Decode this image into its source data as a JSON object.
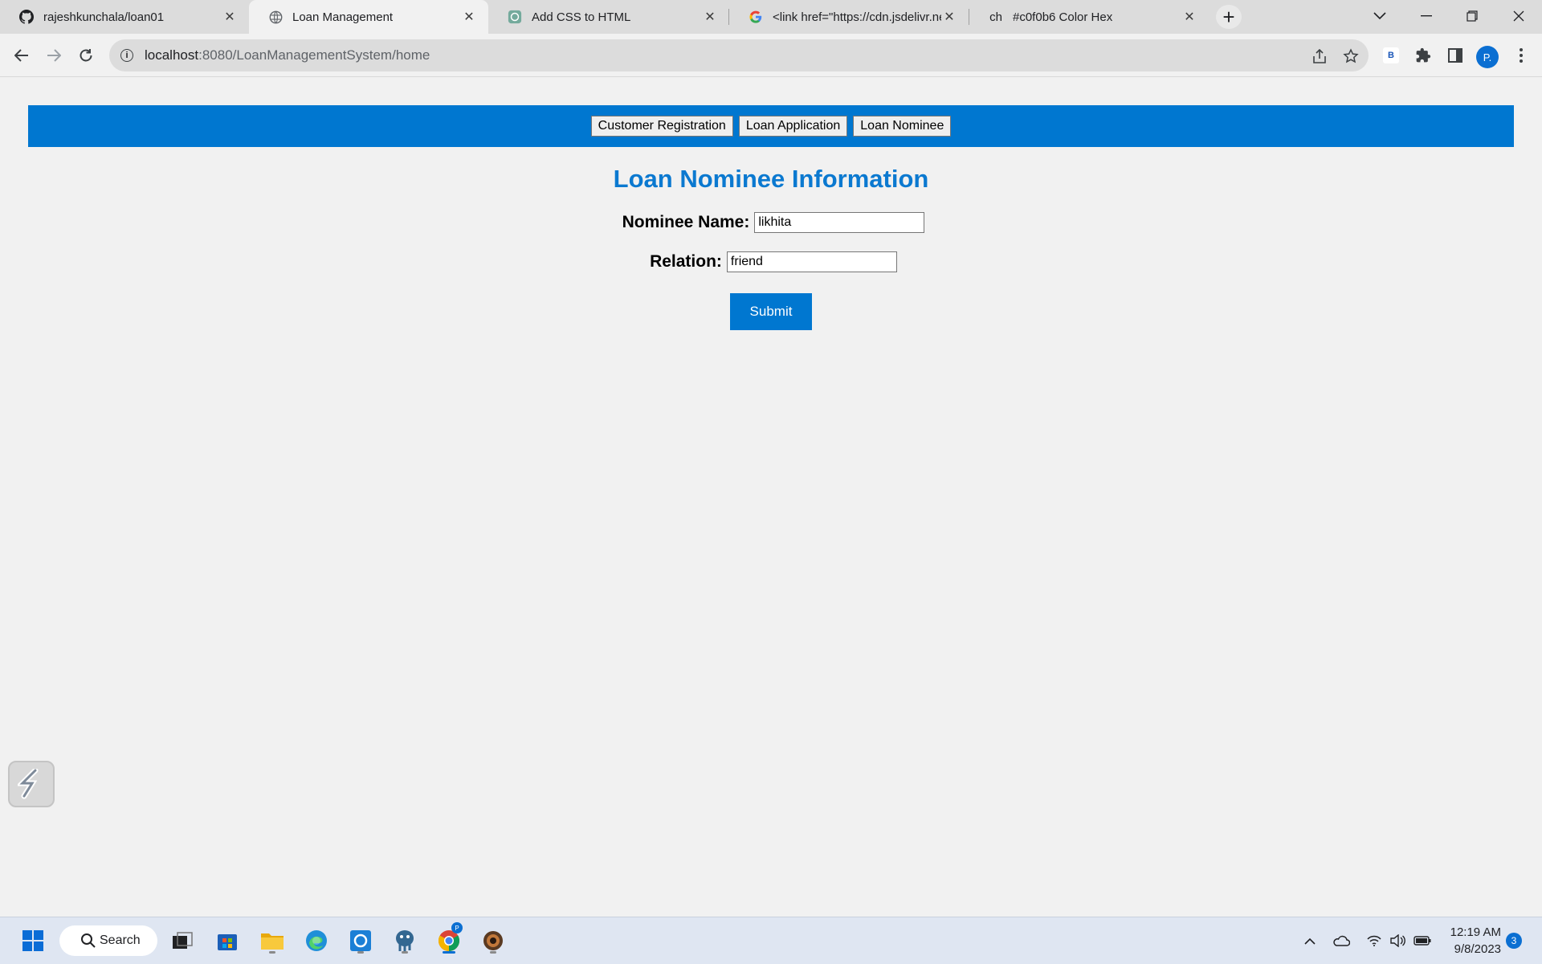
{
  "browser": {
    "tabs": [
      {
        "title": "rajeshkunchala/loan01",
        "favicon": "github-icon",
        "active": false
      },
      {
        "title": "Loan Management",
        "favicon": "globe-icon",
        "active": true
      },
      {
        "title": "Add CSS to HTML",
        "favicon": "chatgpt-icon",
        "active": false
      },
      {
        "title": "<link href=\"https://cdn.jsdelivr.ne",
        "favicon": "google-icon",
        "active": false
      },
      {
        "title": "#c0f0b6 Color Hex",
        "favicon_text": "ch",
        "active": false
      }
    ],
    "address": {
      "host": "localhost",
      "path": ":8080/LoanManagementSystem/home"
    },
    "profile_initial": "P.",
    "extension_badge": "B"
  },
  "page": {
    "nav": {
      "customer_registration": "Customer Registration",
      "loan_application": "Loan Application",
      "loan_nominee": "Loan Nominee"
    },
    "title": "Loan Nominee Information",
    "form": {
      "nominee_name_label": "Nominee Name:",
      "nominee_name_value": "likhita",
      "relation_label": "Relation:",
      "relation_value": "friend",
      "submit_label": "Submit"
    }
  },
  "taskbar": {
    "search_label": "Search",
    "time": "12:19 AM",
    "date": "9/8/2023",
    "notification_count": "3"
  },
  "colors": {
    "nav_bar": "#0077d0",
    "title": "#0b79d0",
    "submit": "#0077d0"
  }
}
